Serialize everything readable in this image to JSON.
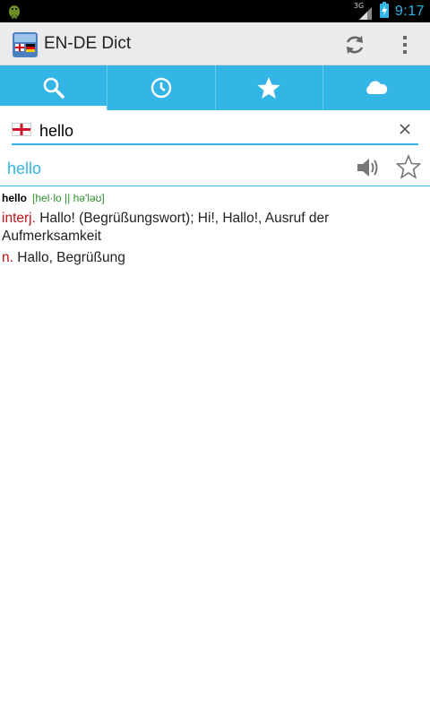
{
  "status_bar": {
    "time": "9:17",
    "network_label": "3G",
    "icons": [
      "android-icon",
      "signal-icon",
      "battery-charging-icon"
    ]
  },
  "action_bar": {
    "title": "EN-DE Dict",
    "icons": [
      "app-logo-icon",
      "sync-icon",
      "overflow-menu-icon"
    ]
  },
  "tabs": [
    {
      "icon": "search-icon",
      "active": true
    },
    {
      "icon": "history-icon",
      "active": false
    },
    {
      "icon": "favorites-star-icon",
      "active": false
    },
    {
      "icon": "cloud-icon",
      "active": false
    }
  ],
  "search": {
    "value": "hello",
    "language_flag": "english-flag-icon"
  },
  "result": {
    "headword": "hello",
    "entry": {
      "word": "hello",
      "pronunciation": "[hel·lo || hə'ləʊ]",
      "senses": [
        {
          "pos": "interj.",
          "text": "Hallo! (Begrüßungswort); Hi!, Hallo!, Ausruf der Aufmerksamkeit"
        },
        {
          "pos": "n.",
          "text": "Hallo, Begrüßung"
        }
      ]
    }
  },
  "colors": {
    "accent": "#33b5e5",
    "pos_color": "#c0131a",
    "pronunciation_color": "#2e8b2e",
    "action_bar_bg": "#ebebeb"
  }
}
